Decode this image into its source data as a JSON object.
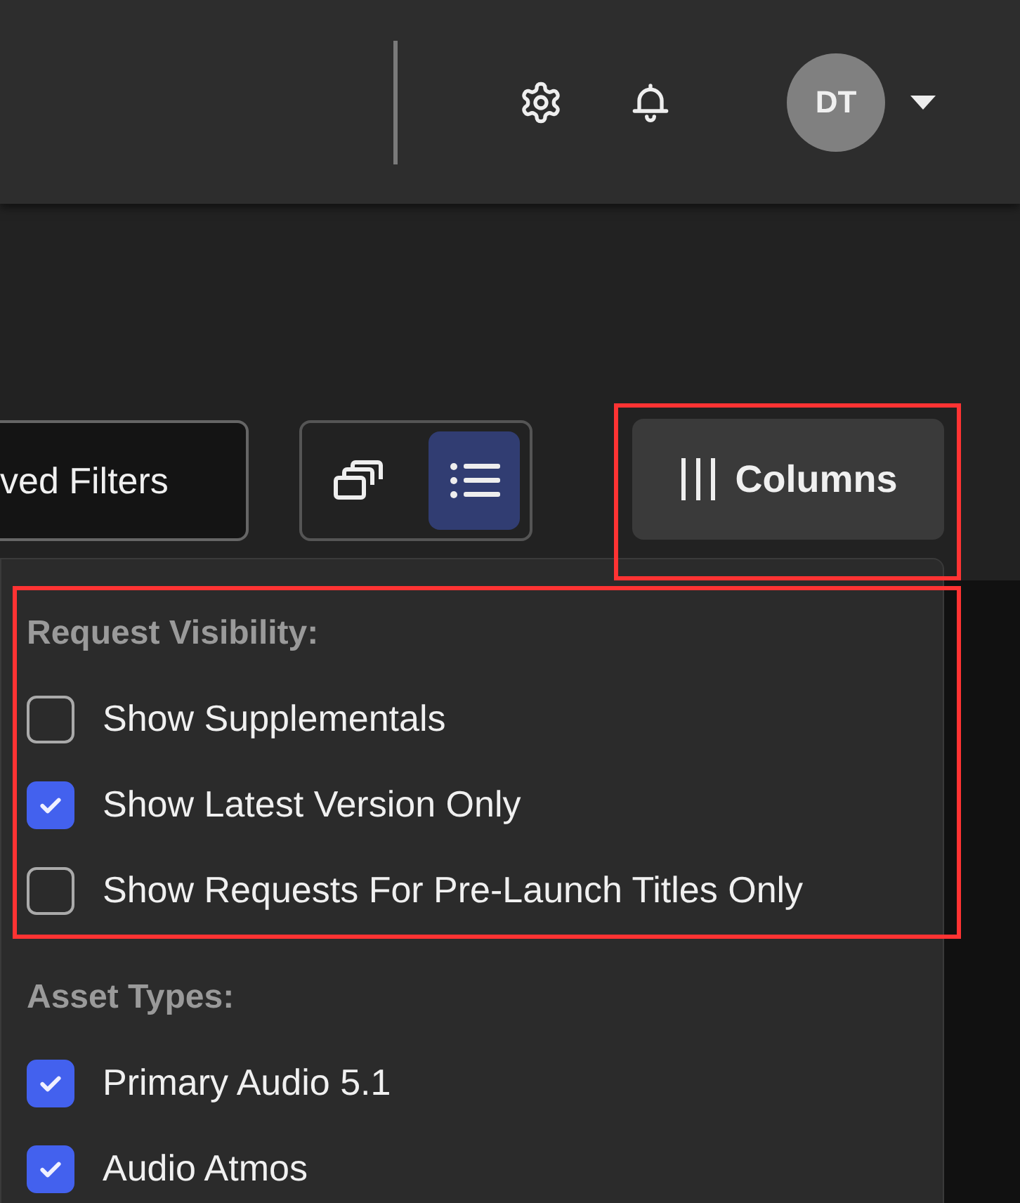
{
  "header": {
    "avatar_initials": "DT"
  },
  "toolbar": {
    "saved_filters_label": "ved Filters",
    "view_toggle": [
      {
        "kind": "cards",
        "selected": false
      },
      {
        "kind": "list",
        "selected": true
      }
    ],
    "columns_button": {
      "label": "Columns",
      "highlighted": true
    }
  },
  "menu": {
    "sections": [
      {
        "title": "Request Visibility:",
        "highlighted": true,
        "options": [
          {
            "label": "Show Supplementals",
            "checked": false
          },
          {
            "label": "Show Latest Version Only",
            "checked": true
          },
          {
            "label": "Show Requests For Pre-Launch Titles Only",
            "checked": false
          }
        ]
      },
      {
        "title": "Asset Types:",
        "highlighted": false,
        "options": [
          {
            "label": "Primary Audio 5.1",
            "checked": true
          },
          {
            "label": "Audio Atmos",
            "checked": true
          }
        ]
      }
    ]
  }
}
